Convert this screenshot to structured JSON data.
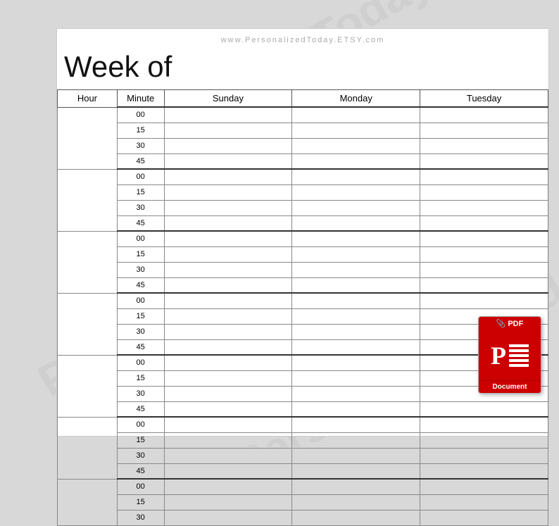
{
  "website": "www.PersonalizedToday.ETSY.com",
  "title": "Week of",
  "table": {
    "headers": {
      "hour": "Hour",
      "minute": "Minute",
      "days": [
        "Sunday",
        "Monday",
        "Tuesday"
      ]
    },
    "hours": [
      {
        "rows": [
          {
            "min": "00"
          },
          {
            "min": "15"
          },
          {
            "min": "30"
          },
          {
            "min": "45"
          }
        ]
      },
      {
        "rows": [
          {
            "min": "00"
          },
          {
            "min": "15"
          },
          {
            "min": "30"
          },
          {
            "min": "45"
          }
        ]
      },
      {
        "rows": [
          {
            "min": "00"
          },
          {
            "min": "15"
          },
          {
            "min": "30"
          },
          {
            "min": "45"
          }
        ]
      },
      {
        "rows": [
          {
            "min": "00"
          },
          {
            "min": "15"
          },
          {
            "min": "30"
          },
          {
            "min": "45"
          }
        ]
      },
      {
        "rows": [
          {
            "min": "00"
          },
          {
            "min": "15"
          },
          {
            "min": "30"
          },
          {
            "min": "45"
          }
        ]
      },
      {
        "rows": [
          {
            "min": "00"
          },
          {
            "min": "15"
          },
          {
            "min": "30"
          },
          {
            "min": "45"
          }
        ]
      },
      {
        "rows": [
          {
            "min": "00"
          },
          {
            "min": "15"
          },
          {
            "min": "30"
          }
        ]
      }
    ]
  },
  "pdf_icon": {
    "header": "PDF",
    "letter": "P",
    "footer": "Document"
  },
  "watermark_text": "Personalized Today"
}
